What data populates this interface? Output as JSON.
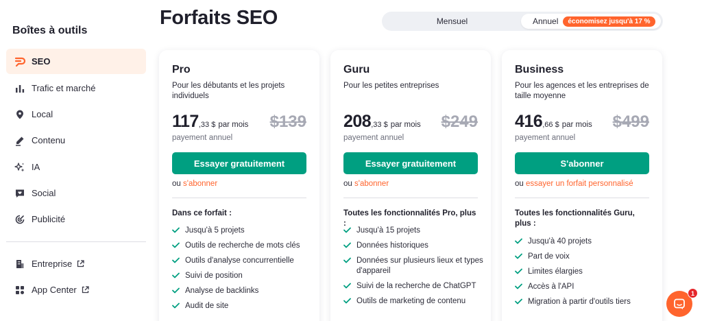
{
  "sidebar": {
    "title": "Boîtes à outils",
    "items": [
      {
        "label": "SEO",
        "icon": "seo-logo-icon",
        "active": true
      },
      {
        "label": "Trafic et marché",
        "icon": "bar-chart-icon"
      },
      {
        "label": "Local",
        "icon": "map-pin-icon"
      },
      {
        "label": "Contenu",
        "icon": "pen-icon"
      },
      {
        "label": "IA",
        "icon": "sparkles-icon"
      },
      {
        "label": "Social",
        "icon": "chat-heart-icon"
      },
      {
        "label": "Publicité",
        "icon": "target-icon"
      }
    ],
    "bottom_items": [
      {
        "label": "Entreprise",
        "icon": "building-icon",
        "external": true
      },
      {
        "label": "App Center",
        "icon": "grid-icon",
        "external": true
      }
    ]
  },
  "header": {
    "title": "Forfaits SEO",
    "billing_toggle": {
      "monthly": "Mensuel",
      "annual": "Annuel",
      "badge": "économisez jusqu'à 17 %",
      "selected": "Annuel"
    }
  },
  "plans": [
    {
      "name": "Pro",
      "description": "Pour les débutants et les projets individuels",
      "price_main": "117",
      "price_cents": ",33 $",
      "price_period": "par mois",
      "price_old": "$139",
      "billing": "payement annuel",
      "cta": "Essayer gratuitement",
      "alt_prefix": "ou",
      "alt_link": "s'abonner",
      "features_title": "Dans ce forfait :",
      "features": [
        "Jusqu'à 5 projets",
        "Outils de recherche de mots clés",
        "Outils d'analyse concurrentielle",
        "Suivi de position",
        "Analyse de backlinks",
        "Audit de site"
      ]
    },
    {
      "name": "Guru",
      "description": "Pour les petites entreprises",
      "price_main": "208",
      "price_cents": ",33 $",
      "price_period": "par mois",
      "price_old": "$249",
      "billing": "payement annuel",
      "cta": "Essayer gratuitement",
      "alt_prefix": "ou",
      "alt_link": "s'abonner",
      "features_title": "Toutes les fonctionnalités Pro, plus :",
      "features": [
        "Jusqu'à 15 projets",
        "Données historiques",
        "Données sur plusieurs lieux et types d'appareil",
        "Suivi de la recherche de ChatGPT",
        "Outils de marketing de contenu"
      ]
    },
    {
      "name": "Business",
      "description": "Pour les agences et les entreprises de taille moyenne",
      "price_main": "416",
      "price_cents": ",66 $",
      "price_period": "par mois",
      "price_old": "$499",
      "billing": "payement annuel",
      "cta": "S'abonner",
      "alt_prefix": "ou",
      "alt_link": "essayer un forfait personnalisé",
      "features_title": "Toutes les fonctionnalités Guru, plus :",
      "features": [
        "Jusqu'à 40 projets",
        "Part de voix",
        "Limites élargies",
        "Accès à l'API",
        "Migration à partir d'outils tiers"
      ]
    }
  ],
  "chat": {
    "badge_count": "1"
  },
  "colors": {
    "accent": "#ff642d",
    "primary_button": "#009f81",
    "check": "#009f81",
    "active_bg": "#fff1e8"
  }
}
